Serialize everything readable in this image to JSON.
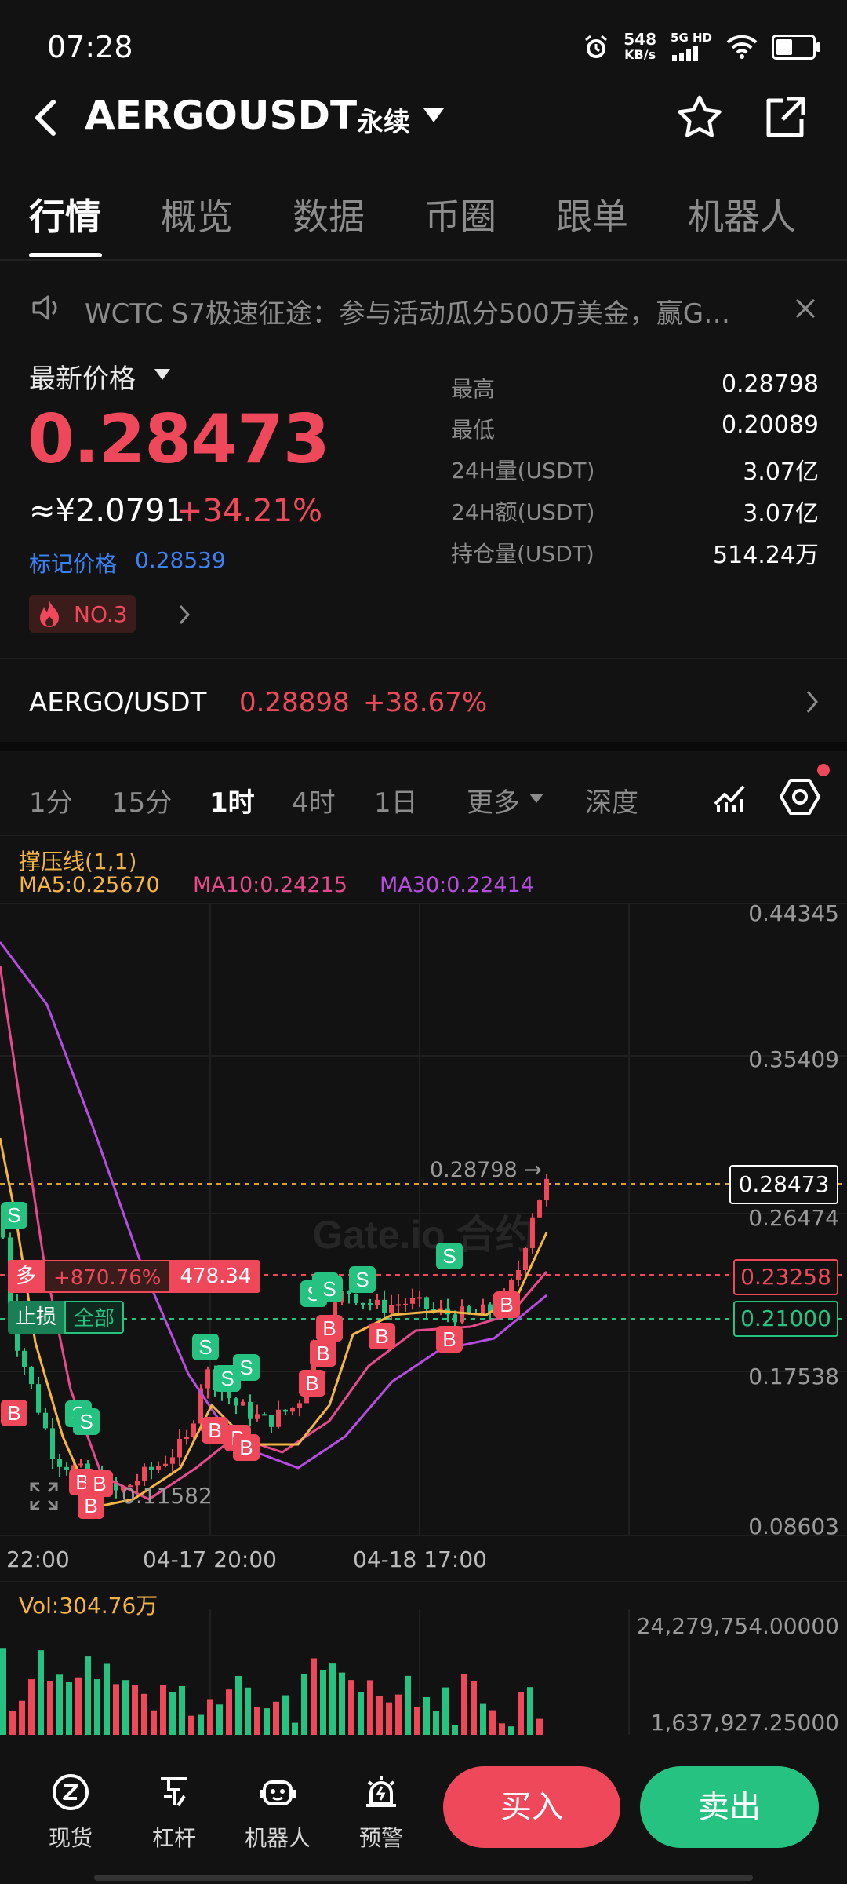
{
  "status_bar": {
    "time": "07:28",
    "net_speed": "548",
    "net_unit": "KB/s",
    "net_type": "5G HD",
    "icons": [
      "alarm-icon",
      "signal-icon",
      "wifi-icon",
      "battery-icon"
    ]
  },
  "header": {
    "pair": "AERGOUSDT",
    "suffix": "永续",
    "icons": [
      "back-icon",
      "dropdown-icon",
      "star-icon",
      "share-icon"
    ]
  },
  "tabs": [
    "行情",
    "概览",
    "数据",
    "币圈",
    "跟单",
    "机器人"
  ],
  "announcement": {
    "text": "WCTC S7极速征途：参与活动瓜分500万美金，赢G…"
  },
  "price": {
    "label": "最新价格",
    "last": "0.28473",
    "cny": "≈¥2.0791",
    "change": "+34.21%",
    "mark_label": "标记价格",
    "mark_value": "0.28539",
    "hot_rank": "NO.3"
  },
  "stats": [
    {
      "label": "最高",
      "value": "0.28798"
    },
    {
      "label": "最低",
      "value": "0.20089"
    },
    {
      "label": "24H量(USDT)",
      "value": "3.07亿"
    },
    {
      "label": "24H额(USDT)",
      "value": "3.07亿"
    },
    {
      "label": "持仓量(USDT)",
      "value": "514.24万"
    }
  ],
  "spot": {
    "pair": "AERGO/USDT",
    "price": "0.28898",
    "change": "+38.67%"
  },
  "intervals": [
    "1分",
    "15分",
    "1时",
    "4时",
    "1日",
    "更多",
    "深度"
  ],
  "indicators": {
    "line": "撑压线(1,1)",
    "ma5": "MA5:0.25670",
    "ma10": "MA10:0.24215",
    "ma30": "MA30:0.22414"
  },
  "chart": {
    "y_ticks": [
      "0.44345",
      "0.35409",
      "0.26474",
      "0.17538",
      "0.08603"
    ],
    "x_ticks": [
      "22:00",
      "04-17 20:00",
      "04-18 17:00"
    ],
    "high_marker": "0.28798 →",
    "low_marker": "0.11582",
    "last_price_tag": "0.28473",
    "entry_tag": "0.23258",
    "stop_tag": "0.21000",
    "position_side": "多",
    "position_pnl": "+870.76%",
    "position_size": "478.34",
    "stop_label": "止损",
    "stop_scope": "全部",
    "watermark": "Gate.io 合约",
    "buy_marker": "B",
    "sell_marker": "S",
    "colors": {
      "up": "#f0485b",
      "down": "#26c281",
      "ma5": "#f5b544",
      "ma10": "#e64a8a",
      "ma30": "#b64ce0"
    }
  },
  "volume": {
    "label": "Vol:304.76万",
    "top_tick": "24,279,754.00000",
    "bottom_tick": "1,637,927.25000"
  },
  "bottom_nav": [
    {
      "label": "现货",
      "icon": "spot-icon"
    },
    {
      "label": "杠杆",
      "icon": "leverage-icon"
    },
    {
      "label": "机器人",
      "icon": "robot-icon"
    },
    {
      "label": "预警",
      "icon": "alert-icon"
    }
  ],
  "actions": {
    "buy": "买入",
    "sell": "卖出"
  }
}
